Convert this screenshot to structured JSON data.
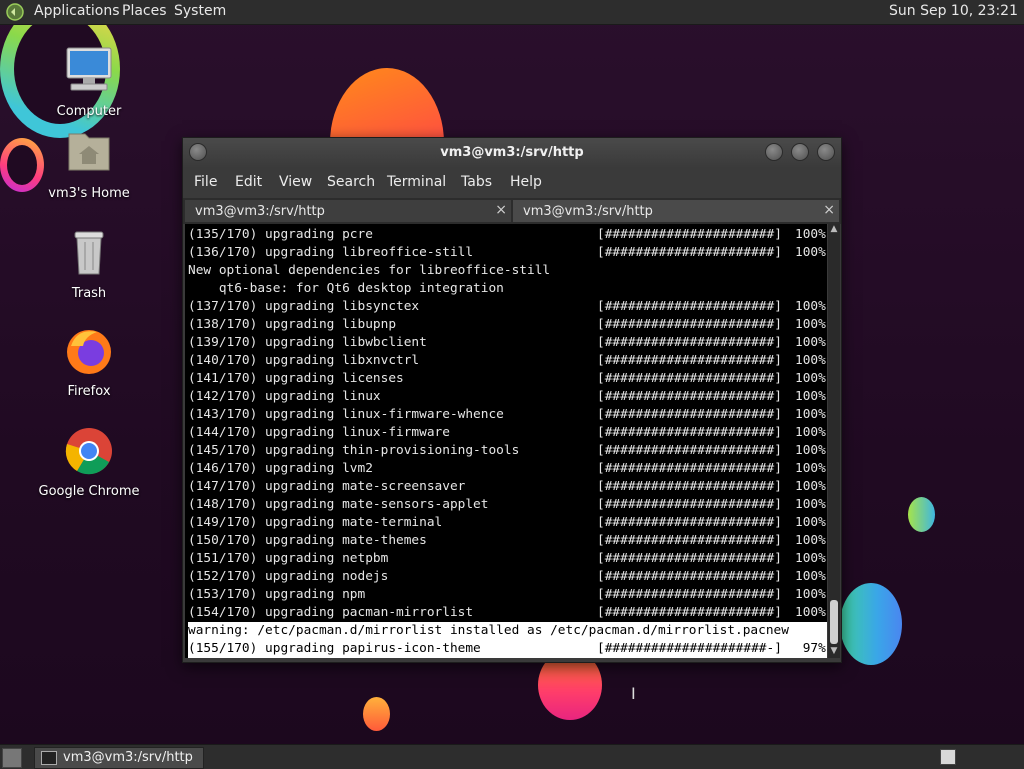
{
  "top_panel": {
    "menus": [
      "Applications",
      "Places",
      "System"
    ],
    "clock": "Sun Sep 10, 23:21"
  },
  "desktop_icons": [
    {
      "label": "Computer"
    },
    {
      "label": "vm3's Home"
    },
    {
      "label": "Trash"
    },
    {
      "label": "Firefox"
    },
    {
      "label": "Google Chrome"
    }
  ],
  "window": {
    "title": "vm3@vm3:/srv/http",
    "menu": [
      "File",
      "Edit",
      "View",
      "Search",
      "Terminal",
      "Tabs",
      "Help"
    ],
    "tabs": [
      {
        "label": "vm3@vm3:/srv/http",
        "close": "×"
      },
      {
        "label": "vm3@vm3:/srv/http",
        "close": "×"
      }
    ]
  },
  "terminal": {
    "lines": [
      {
        "msg": "(135/170) upgrading pcre",
        "bar": "[######################]",
        "pct": "100%"
      },
      {
        "msg": "(136/170) upgrading libreoffice-still",
        "bar": "[######################]",
        "pct": "100%"
      },
      {
        "msg": "New optional dependencies for libreoffice-still",
        "bar": "",
        "pct": ""
      },
      {
        "msg": "    qt6-base: for Qt6 desktop integration",
        "bar": "",
        "pct": ""
      },
      {
        "msg": "(137/170) upgrading libsynctex",
        "bar": "[######################]",
        "pct": "100%"
      },
      {
        "msg": "(138/170) upgrading libupnp",
        "bar": "[######################]",
        "pct": "100%"
      },
      {
        "msg": "(139/170) upgrading libwbclient",
        "bar": "[######################]",
        "pct": "100%"
      },
      {
        "msg": "(140/170) upgrading libxnvctrl",
        "bar": "[######################]",
        "pct": "100%"
      },
      {
        "msg": "(141/170) upgrading licenses",
        "bar": "[######################]",
        "pct": "100%"
      },
      {
        "msg": "(142/170) upgrading linux",
        "bar": "[######################]",
        "pct": "100%"
      },
      {
        "msg": "(143/170) upgrading linux-firmware-whence",
        "bar": "[######################]",
        "pct": "100%"
      },
      {
        "msg": "(144/170) upgrading linux-firmware",
        "bar": "[######################]",
        "pct": "100%"
      },
      {
        "msg": "(145/170) upgrading thin-provisioning-tools",
        "bar": "[######################]",
        "pct": "100%"
      },
      {
        "msg": "(146/170) upgrading lvm2",
        "bar": "[######################]",
        "pct": "100%"
      },
      {
        "msg": "(147/170) upgrading mate-screensaver",
        "bar": "[######################]",
        "pct": "100%"
      },
      {
        "msg": "(148/170) upgrading mate-sensors-applet",
        "bar": "[######################]",
        "pct": "100%"
      },
      {
        "msg": "(149/170) upgrading mate-terminal",
        "bar": "[######################]",
        "pct": "100%"
      },
      {
        "msg": "(150/170) upgrading mate-themes",
        "bar": "[######################]",
        "pct": "100%"
      },
      {
        "msg": "(151/170) upgrading netpbm",
        "bar": "[######################]",
        "pct": "100%"
      },
      {
        "msg": "(152/170) upgrading nodejs",
        "bar": "[######################]",
        "pct": "100%"
      },
      {
        "msg": "(153/170) upgrading npm",
        "bar": "[######################]",
        "pct": "100%"
      },
      {
        "msg": "(154/170) upgrading pacman-mirrorlist",
        "bar": "[######################]",
        "pct": "100%"
      },
      {
        "msg": "warning: /etc/pacman.d/mirrorlist installed as /etc/pacman.d/mirrorlist.pacnew",
        "bar": "",
        "pct": ""
      },
      {
        "msg": "(155/170) upgrading papirus-icon-theme",
        "bar": "[#####################-]",
        "pct": " 97%"
      }
    ]
  },
  "taskbar": {
    "task_label": "vm3@vm3:/srv/http"
  },
  "colors": {
    "panel": "#2d2d2d",
    "terminal_bg": "#000000",
    "terminal_fg": "#e6e6e6",
    "wallpaper": "#200a22"
  }
}
